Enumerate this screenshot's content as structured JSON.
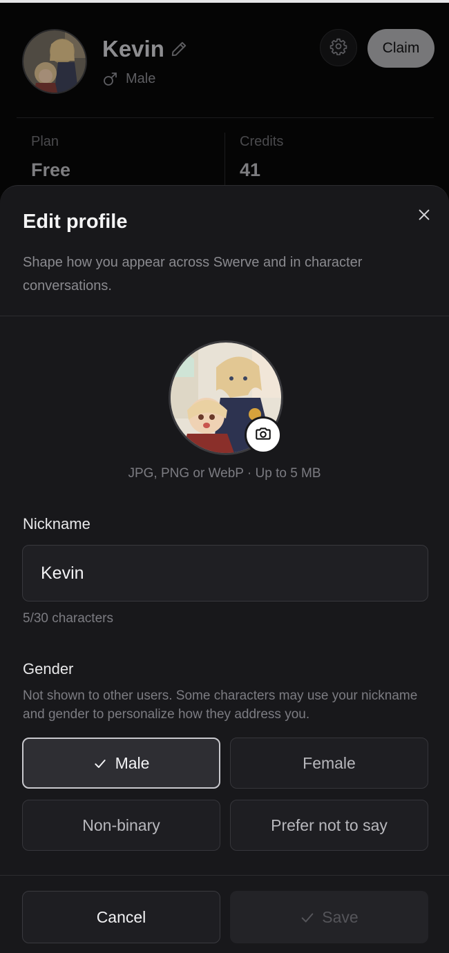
{
  "profile": {
    "name": "Kevin",
    "gender": "Male",
    "claim_label": "Claim",
    "plan_label": "Plan",
    "plan_value": "Free",
    "credits_label": "Credits",
    "credits_value": "41"
  },
  "icons": {
    "edit": "pencil-icon",
    "gender": "male-symbol-icon",
    "settings": "gear-icon",
    "close": "close-icon",
    "camera": "camera-icon",
    "check": "check-icon"
  },
  "sheet": {
    "title": "Edit profile",
    "description": "Shape how you appear across Swerve and in character conversations.",
    "upload_hint": "JPG, PNG or WebP · Up to 5 MB",
    "nickname_label": "Nickname",
    "nickname_value": "Kevin",
    "char_count": "5/30 characters",
    "gender_label": "Gender",
    "gender_help": "Not shown to other users. Some characters may use your nickname and gender to personalize how they address you.",
    "gender_options": [
      "Male",
      "Female",
      "Non-binary",
      "Prefer not to say"
    ],
    "selected_gender": "Male",
    "cancel_label": "Cancel",
    "save_label": "Save"
  },
  "colors": {
    "sheet_bg": "#18181b",
    "accent_border": "#c9c9ce",
    "page_bg": "#000000"
  }
}
